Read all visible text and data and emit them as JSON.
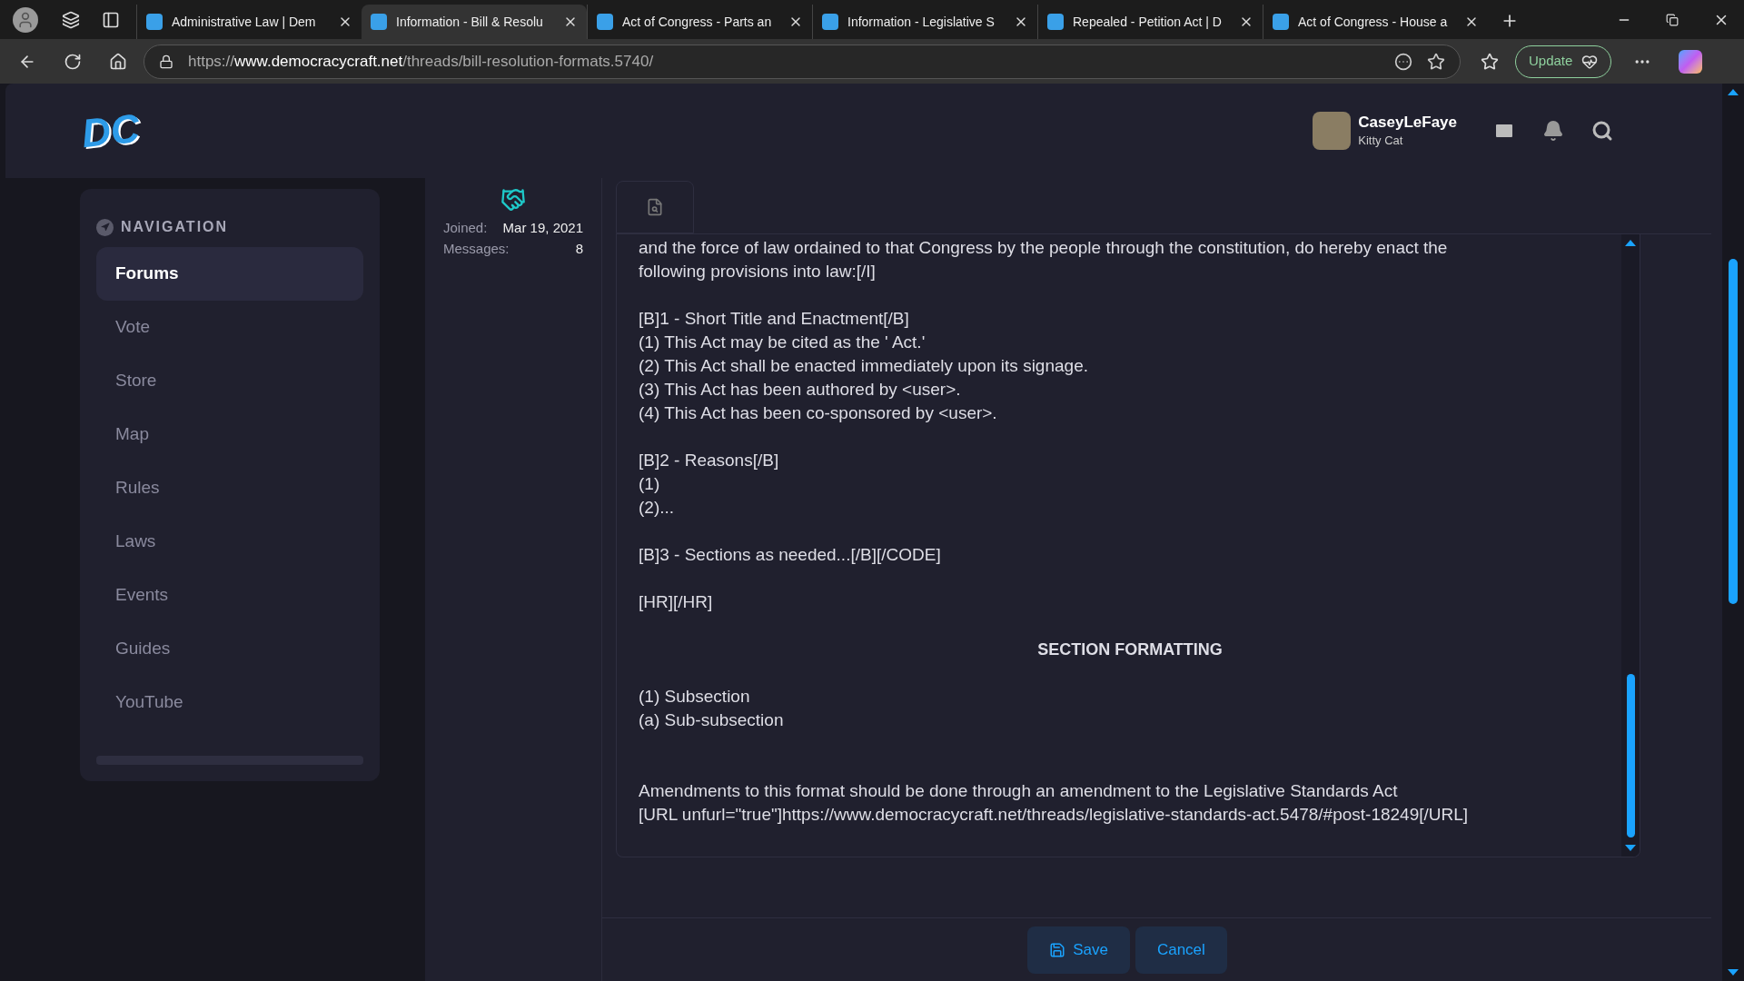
{
  "browser": {
    "tabs": [
      {
        "title": "Administrative Law | Dem",
        "selected": false
      },
      {
        "title": "Information - Bill & Resolu",
        "selected": true
      },
      {
        "title": "Act of Congress - Parts an",
        "selected": false
      },
      {
        "title": "Information - Legislative S",
        "selected": false
      },
      {
        "title": "Repealed - Petition Act | D",
        "selected": false
      },
      {
        "title": "Act of Congress - House a",
        "selected": false
      }
    ],
    "address": {
      "scheme": "https://",
      "host": "www.democracycraft.net",
      "path": "/threads/bill-resolution-formats.5740/"
    },
    "update_button": "Update"
  },
  "site": {
    "logo_text": "DC",
    "user": {
      "name": "CaseyLeFaye",
      "title": "Kitty Cat"
    }
  },
  "navigation": {
    "heading": "NAVIGATION",
    "items": [
      {
        "label": "Forums",
        "selected": true
      },
      {
        "label": "Vote",
        "selected": false
      },
      {
        "label": "Store",
        "selected": false
      },
      {
        "label": "Map",
        "selected": false
      },
      {
        "label": "Rules",
        "selected": false
      },
      {
        "label": "Laws",
        "selected": false
      },
      {
        "label": "Events",
        "selected": false
      },
      {
        "label": "Guides",
        "selected": false
      },
      {
        "label": "YouTube",
        "selected": false
      }
    ]
  },
  "member": {
    "stats": [
      {
        "label": "Joined:",
        "value": "Mar 19, 2021"
      },
      {
        "label": "Messages:",
        "value": "8"
      }
    ]
  },
  "editor": {
    "lines": [
      {
        "kind": "text",
        "text": "and the force of law ordained to that Congress by the people through the constitution, do hereby enact the"
      },
      {
        "kind": "text",
        "text": "following provisions into law:[/I]"
      },
      {
        "kind": "blank"
      },
      {
        "kind": "text",
        "text": "[B]1 - Short Title and Enactment[/B]"
      },
      {
        "kind": "text",
        "text": "(1) This Act may be cited as the ' Act.'"
      },
      {
        "kind": "text",
        "text": "(2) This Act shall be enacted immediately upon its signage."
      },
      {
        "kind": "text",
        "text": "(3) This Act has been authored by <user>."
      },
      {
        "kind": "text",
        "text": "(4) This Act has been co-sponsored by <user>."
      },
      {
        "kind": "blank"
      },
      {
        "kind": "text",
        "text": "[B]2 - Reasons[/B]"
      },
      {
        "kind": "text",
        "text": "(1)"
      },
      {
        "kind": "text",
        "text": "(2)..."
      },
      {
        "kind": "blank"
      },
      {
        "kind": "text",
        "text": "[B]3 - Sections as needed...[/B][/CODE]"
      },
      {
        "kind": "blank"
      },
      {
        "kind": "text",
        "text": "[HR][/HR]"
      },
      {
        "kind": "blank"
      },
      {
        "kind": "heading",
        "text": "SECTION FORMATTING"
      },
      {
        "kind": "blank"
      },
      {
        "kind": "text",
        "text": "(1) Subsection"
      },
      {
        "kind": "text",
        "text": "(a) Sub-subsection"
      },
      {
        "kind": "blank"
      },
      {
        "kind": "blank"
      },
      {
        "kind": "text",
        "text": "Amendments to this format should be done through an amendment to the Legislative Standards Act"
      },
      {
        "kind": "text",
        "text": "[URL unfurl=\"true\"]https://www.democracycraft.net/threads/legislative-standards-act.5478/#post-18249[/URL]"
      }
    ],
    "buttons": [
      {
        "kind": "save",
        "label": "Save"
      },
      {
        "kind": "cancel",
        "label": "Cancel"
      }
    ]
  }
}
